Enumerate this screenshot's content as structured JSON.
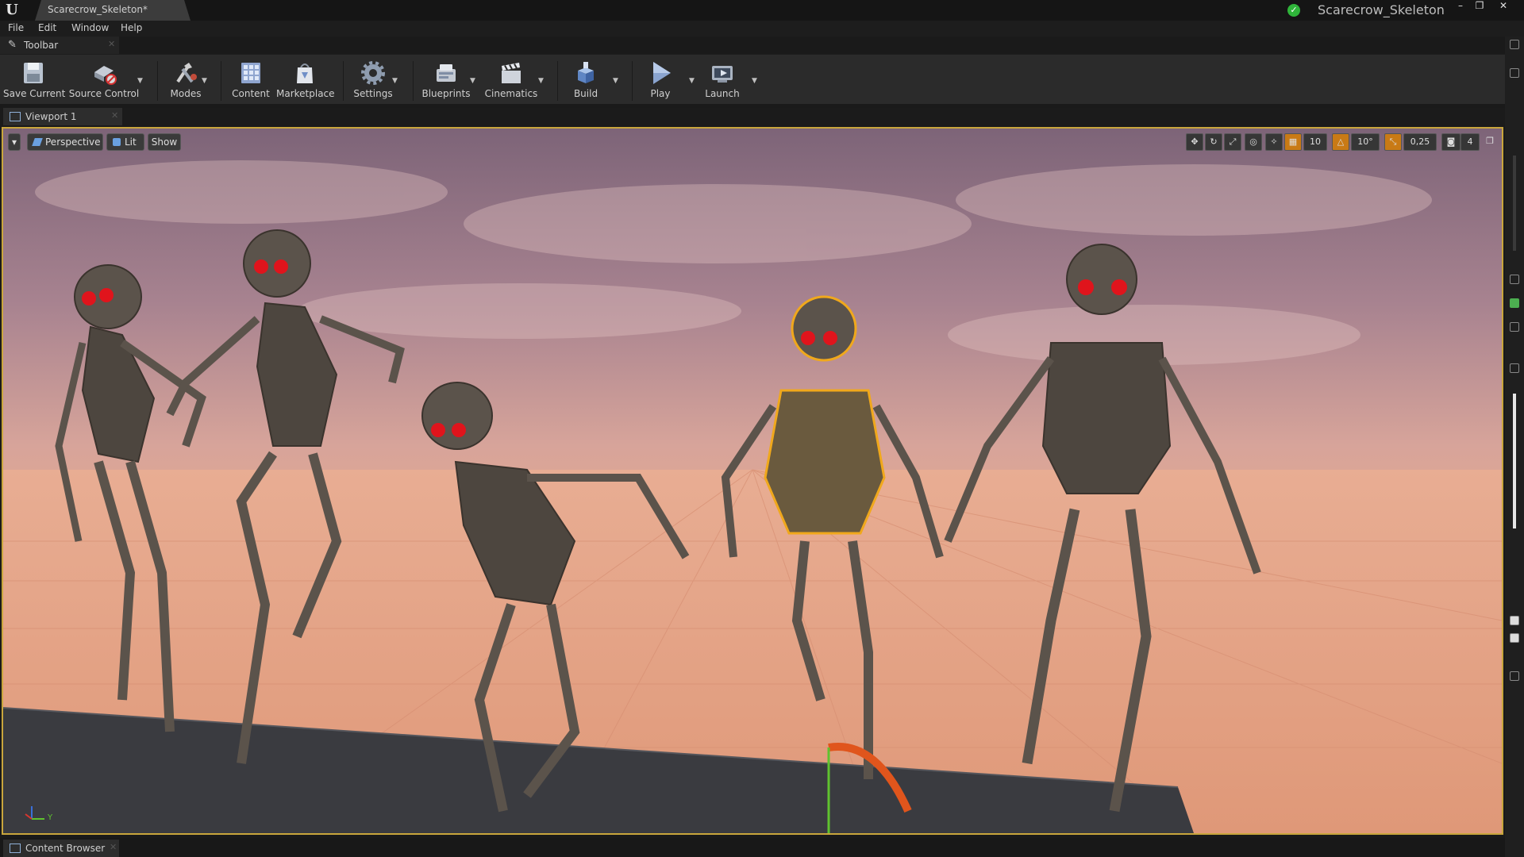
{
  "title_bar": {
    "document_tab": "Scarecrow_Skeleton*",
    "project_name": "Scarecrow_Skeleton",
    "window_buttons": [
      "–",
      "❐",
      "✕"
    ]
  },
  "menu": [
    "File",
    "Edit",
    "Window",
    "Help"
  ],
  "toolbar": {
    "tab_label": "Toolbar",
    "buttons": {
      "save": "Save Current",
      "source_control": "Source Control",
      "modes": "Modes",
      "content": "Content",
      "marketplace": "Marketplace",
      "settings": "Settings",
      "blueprints": "Blueprints",
      "cinematics": "Cinematics",
      "build": "Build",
      "play": "Play",
      "launch": "Launch"
    }
  },
  "viewport": {
    "tab_label": "Viewport 1",
    "view_mode": "Perspective",
    "lighting": "Lit",
    "show": "Show",
    "grid_snap": "10",
    "rotation_snap": "10°",
    "scale_snap": "0,25",
    "camera_speed": "4",
    "axis_labels": {
      "y": "Y"
    },
    "accent_color": "#c97a15",
    "selection_color": "#c9a63c"
  },
  "bottom": {
    "content_browser_tab": "Content Browser"
  }
}
